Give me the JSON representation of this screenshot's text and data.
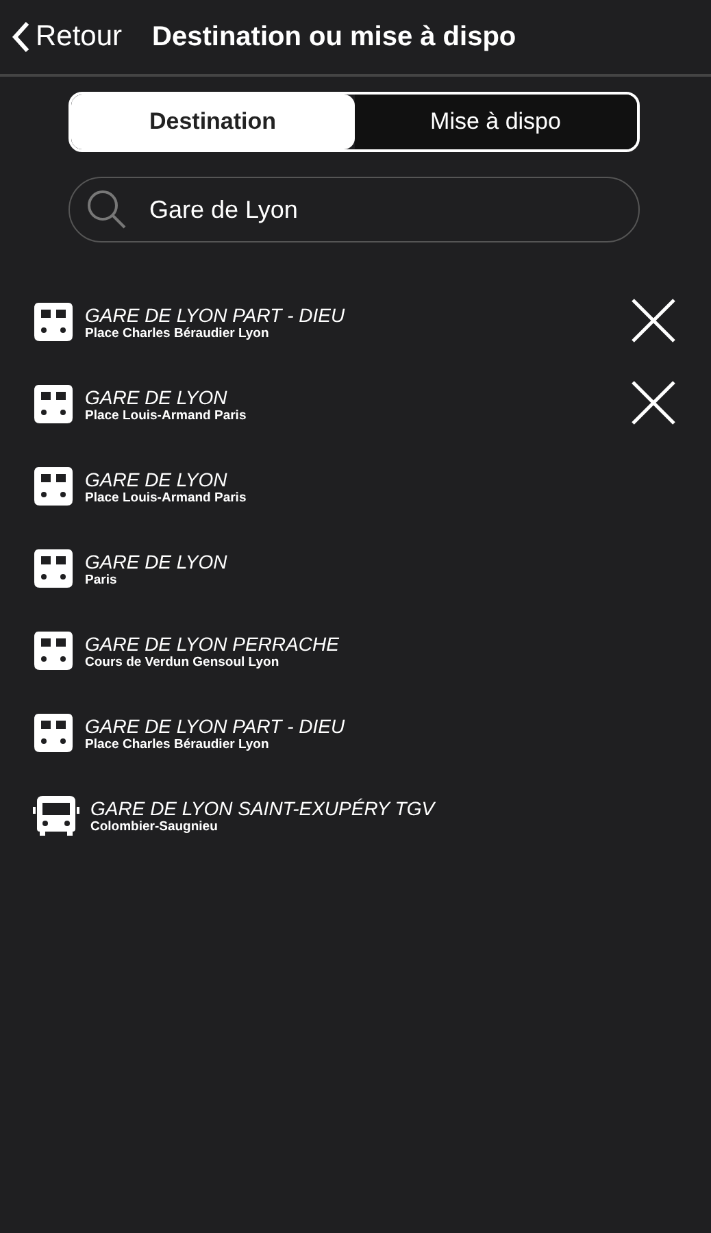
{
  "header": {
    "back_label": "Retour",
    "title": "Destination ou mise à dispo"
  },
  "tabs": [
    {
      "label": "Destination",
      "selected": true
    },
    {
      "label": "Mise à dispo",
      "selected": false
    }
  ],
  "search": {
    "value": "Gare de Lyon"
  },
  "results": [
    {
      "kind": "train",
      "name": "GARE DE LYON PART - DIEU",
      "address": "Place Charles Béraudier Lyon",
      "removable": true
    },
    {
      "kind": "train",
      "name": "GARE DE LYON",
      "address": "Place Louis-Armand Paris",
      "removable": true
    },
    {
      "kind": "train",
      "name": "GARE DE LYON",
      "address": "Place Louis-Armand Paris",
      "removable": false
    },
    {
      "kind": "train",
      "name": "GARE DE LYON",
      "address": "Paris",
      "removable": false
    },
    {
      "kind": "train",
      "name": "GARE DE LYON PERRACHE",
      "address": "Cours de Verdun Gensoul Lyon",
      "removable": false
    },
    {
      "kind": "train",
      "name": "GARE DE LYON PART - DIEU",
      "address": "Place Charles Béraudier Lyon",
      "removable": false
    },
    {
      "kind": "bus",
      "name": "GARE DE LYON SAINT-EXUPÉRY TGV",
      "address": "Colombier-Saugnieu",
      "removable": false
    }
  ]
}
